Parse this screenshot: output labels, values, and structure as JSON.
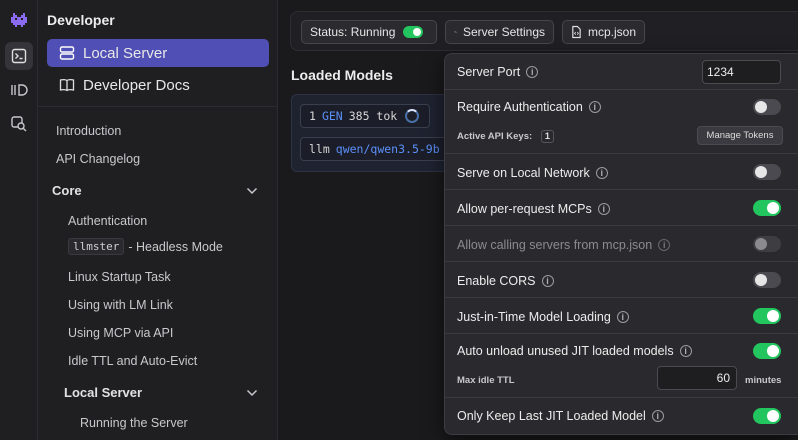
{
  "sidebar": {
    "section_title": "Developer",
    "nav": [
      {
        "label": "Local Server",
        "icon": "server-icon",
        "active": true
      },
      {
        "label": "Developer Docs",
        "icon": "book-icon",
        "active": false
      }
    ],
    "docs": {
      "introduction": "Introduction",
      "api_changelog": "API Changelog",
      "core": "Core",
      "authentication": "Authentication",
      "llmster_code": "llmster",
      "headless_mode": "- Headless Mode",
      "linux_startup": "Linux Startup Task",
      "lm_link": "Using with LM Link",
      "mcp_api": "Using MCP via API",
      "idle_ttl": "Idle TTL and Auto-Evict",
      "local_server": "Local Server",
      "running_server": "Running the Server"
    }
  },
  "toolbar": {
    "status_label": "Status: Running",
    "status_on": true,
    "server_settings_label": "Server Settings",
    "mcp_label": "mcp.json"
  },
  "loaded_models": {
    "title": "Loaded Models",
    "count": "1",
    "gen_label": "GEN",
    "tokens": "385 tok",
    "cmd_prefix": "llm",
    "model_name": "qwen/qwen3.5-9b"
  },
  "settings": {
    "server_port": {
      "label": "Server Port",
      "value": "1234"
    },
    "require_auth": {
      "label": "Require Authentication",
      "enabled": false
    },
    "api_keys": {
      "label": "Active API Keys:",
      "count": "1",
      "button": "Manage Tokens"
    },
    "local_network": {
      "label": "Serve on Local Network",
      "enabled": false
    },
    "per_request_mcps": {
      "label": "Allow per-request MCPs",
      "enabled": true
    },
    "mcp_json_servers": {
      "label": "Allow calling servers from mcp.json",
      "enabled": false,
      "disabled": true
    },
    "cors": {
      "label": "Enable CORS",
      "enabled": false
    },
    "jit_loading": {
      "label": "Just-in-Time Model Loading",
      "enabled": true
    },
    "auto_unload": {
      "label": "Auto unload unused JIT loaded models",
      "enabled": true
    },
    "max_idle_ttl": {
      "label": "Max idle TTL",
      "value": "60",
      "unit": "minutes"
    },
    "keep_last_jit": {
      "label": "Only Keep Last JIT Loaded Model",
      "enabled": true
    }
  },
  "colors": {
    "accent": "#4f4fb5",
    "toggle_on": "#22c55e",
    "link_blue": "#5b8ff9"
  }
}
